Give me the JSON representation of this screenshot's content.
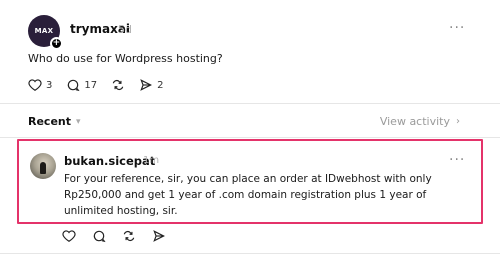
{
  "post": {
    "avatar_text": "MAX",
    "username": "trymaxai",
    "time": "5d",
    "more": "···",
    "text": "Who do use for Wordpress hosting?",
    "actions": {
      "like_count": "3",
      "comment_count": "17",
      "repost_count": "",
      "share_count": "2"
    }
  },
  "filter": {
    "sort_label": "Recent",
    "view_activity_label": "View activity"
  },
  "reply": {
    "username": "bukan.sicepat",
    "time": "1m",
    "more": "···",
    "text": "For your reference, sir, you can place an order at IDwebhost with only Rp250,000 and get 1 year of .com domain registration plus 1 year of unlimited hosting, sir."
  },
  "colors": {
    "highlight_border": "#e4336a",
    "muted_text": "#9a9a9a"
  }
}
